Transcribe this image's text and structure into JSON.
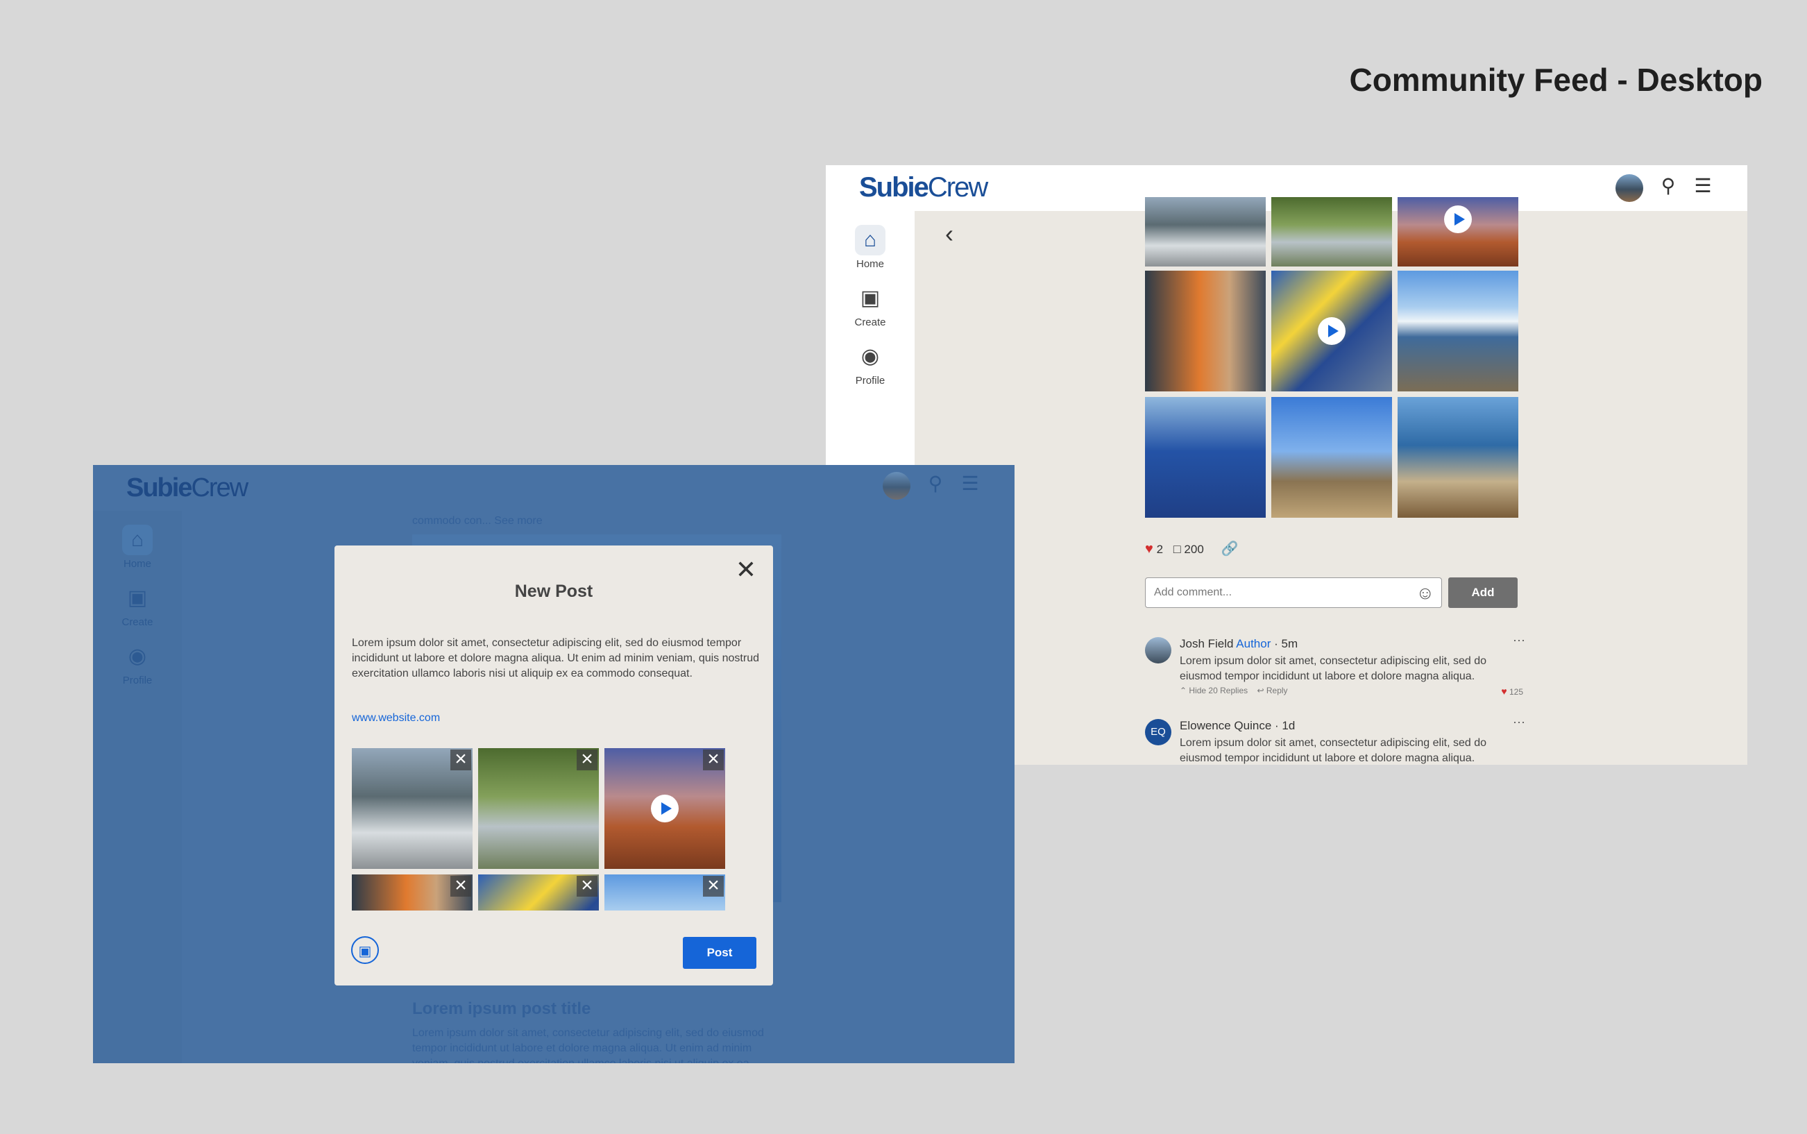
{
  "page_title": "Community Feed - Desktop",
  "brand": {
    "logo_bold": "Subie",
    "logo_light": "Crew"
  },
  "nav": {
    "home": "Home",
    "create": "Create",
    "profile": "Profile"
  },
  "post": {
    "likes": "2",
    "comments": "200"
  },
  "comment_input": {
    "placeholder": "Add comment...",
    "add_label": "Add"
  },
  "comments": [
    {
      "name": "Josh Field",
      "role": "Author",
      "time": "· 5m",
      "text": "Lorem ipsum dolor sit amet, consectetur adipiscing elit, sed do eiusmod tempor incididunt ut labore et dolore magna aliqua.",
      "hide_replies": "Hide 20 Replies",
      "reply": "Reply",
      "likes": "125"
    },
    {
      "initials": "EQ",
      "name": "Elowence Quince",
      "time": "· 1d",
      "text": "Lorem ipsum dolor sit amet, consectetur adipiscing elit, sed do eiusmod tempor incididunt ut labore et dolore magna aliqua."
    }
  ],
  "background_feed": {
    "see_more": "commodo con... See more",
    "post_title": "Lorem ipsum post title",
    "post_text": "Lorem ipsum dolor sit amet, consectetur adipiscing elit, sed do eiusmod tempor incididunt ut labore et dolore magna aliqua. Ut enim ad minim veniam, quis nostrud exercitation ullamco laboris nisi ut aliquip ex ea"
  },
  "modal": {
    "title": "New Post",
    "description": "Lorem ipsum dolor sit amet, consectetur adipiscing elit, sed do eiusmod tempor incididunt ut labore et dolore magna aliqua. Ut enim ad minim veniam, quis nostrud exercitation ullamco laboris nisi ut aliquip ex ea commodo consequat.",
    "link": "www.website.com",
    "post_label": "Post"
  },
  "colors": {
    "brand_blue": "#1565d8",
    "logo_blue": "#1a4e97",
    "overlay_blue": "#4872a4",
    "like_red": "#d32f2f"
  }
}
